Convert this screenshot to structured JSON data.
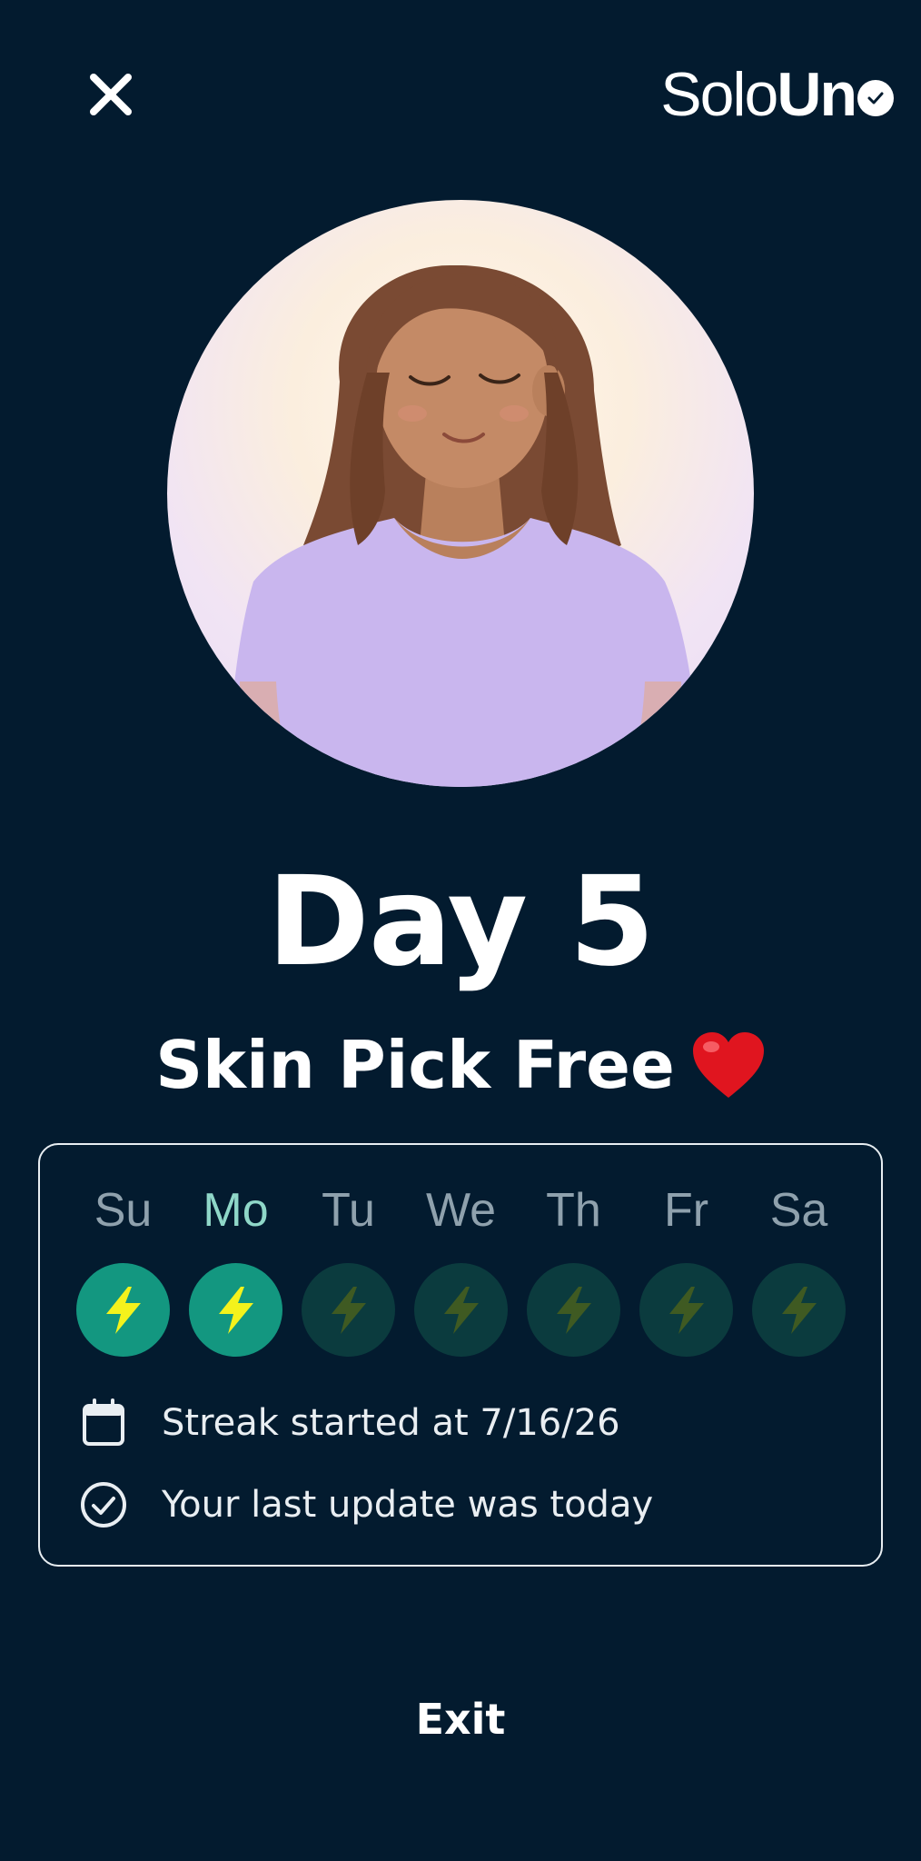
{
  "app": {
    "logo_light": "Solo",
    "logo_bold": "Un"
  },
  "header": {
    "close_icon": "close-icon"
  },
  "hero": {
    "image": "meditating-woman-illustration"
  },
  "streak": {
    "title": "Day 5",
    "subtitle": "Skin Pick Free",
    "subtitle_emoji": "❤️"
  },
  "week": {
    "days": [
      {
        "label": "Su",
        "done": true
      },
      {
        "label": "Mo",
        "done": true
      },
      {
        "label": "Tu",
        "done": false
      },
      {
        "label": "We",
        "done": false
      },
      {
        "label": "Th",
        "done": false
      },
      {
        "label": "Fr",
        "done": false
      },
      {
        "label": "Sa",
        "done": false
      }
    ],
    "icon": "lightning-icon"
  },
  "info": {
    "started": "Streak started at 7/16/26",
    "last_update": "Your last update was today"
  },
  "footer": {
    "exit_label": "Exit"
  },
  "colors": {
    "background": "#031b2f",
    "done_circle": "#139780",
    "pending_circle": "#0b3b3e",
    "bolt_active": "#f4f21c",
    "bolt_inactive": "#3f5a22",
    "active_day_label": "#8fd7c8",
    "inactive_day_label": "#8fa1ad"
  }
}
